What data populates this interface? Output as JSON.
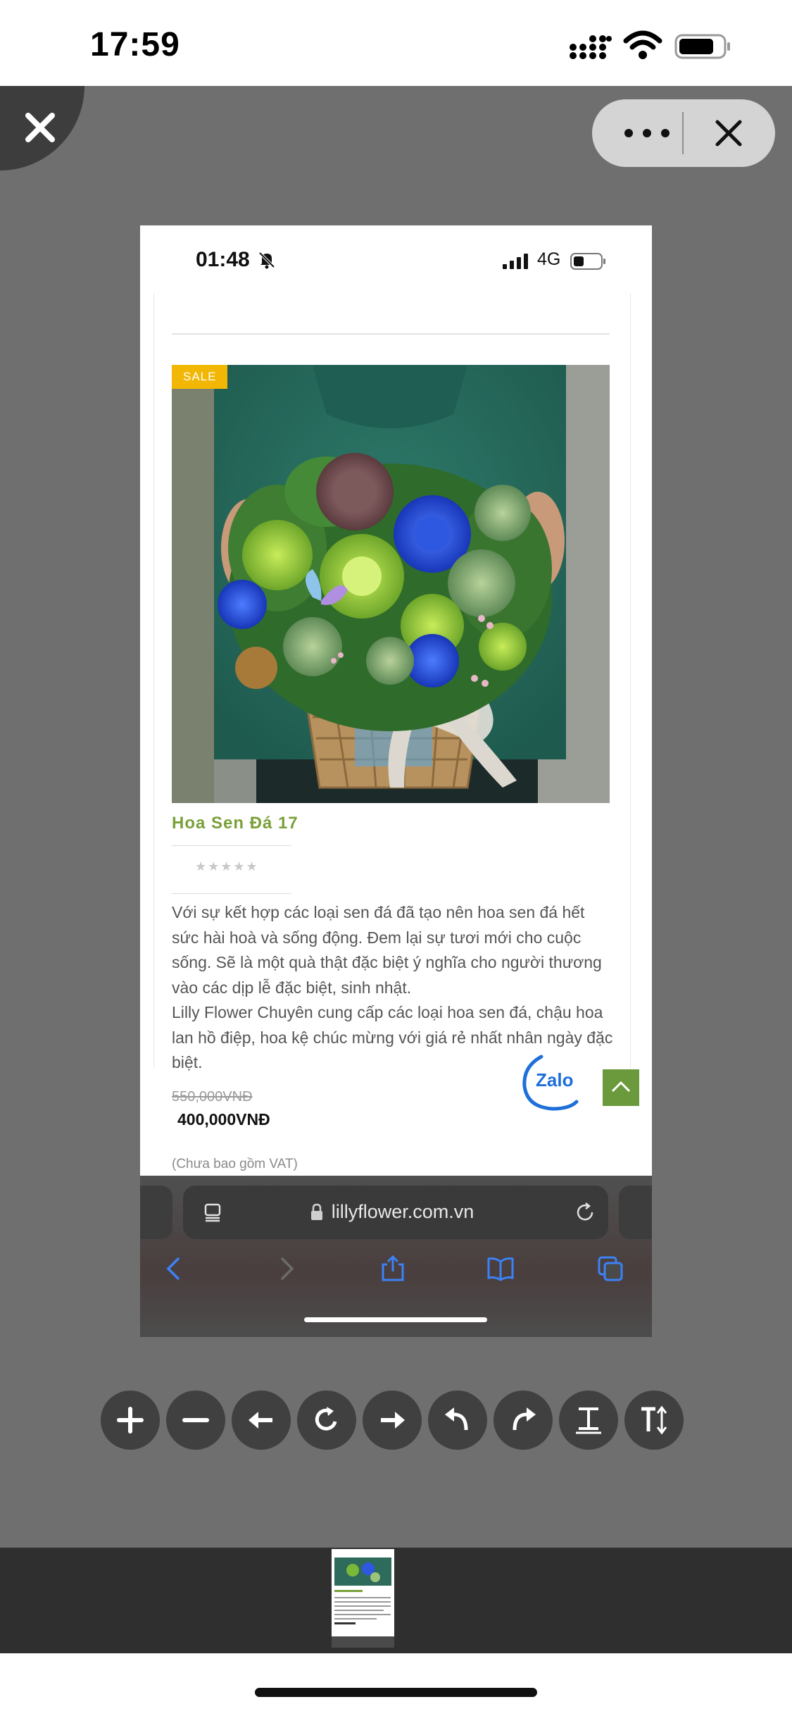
{
  "status_bar": {
    "time": "17:59"
  },
  "viewer": {
    "close_icon": "close-icon",
    "more_icon": "more-dots-icon",
    "pill_close_icon": "close-icon"
  },
  "inner_status": {
    "time": "01:48",
    "network": "4G"
  },
  "product": {
    "sale_badge": "SALE",
    "title": "Hoa Sen Đá 17",
    "stars": "★★★★★",
    "description": "Với sự kết hợp các loại sen đá đã tạo nên hoa sen đá hết sức hài hoà và sống động. Đem lại sự tươi mới cho cuộc sống. Sẽ là một quà thật đặc biệt ý nghĩa cho người thương vào các dịp lễ đặc biệt, sinh nhật.\nLilly Flower Chuyên cung cấp các loại hoa sen đá, chậu hoa lan hồ điệp, hoa kệ chúc mừng với giá rẻ nhất nhân ngày đặc biệt.",
    "price_old": "550,000VNĐ",
    "price_new": "400,000VNĐ",
    "vat_note": "(Chưa bao gồm VAT)"
  },
  "chat_widget": {
    "label": "Zalo"
  },
  "browser": {
    "url": "lillyflower.com.vn"
  },
  "toolbar": {
    "tools": [
      "zoom-in",
      "zoom-out",
      "move-left",
      "rotate",
      "move-right",
      "undo",
      "redo",
      "text-format",
      "text-size"
    ]
  },
  "colors": {
    "viewer_bg": "#6f6f6f",
    "title_green": "#7aa03a",
    "sale_yellow": "#f2b705",
    "back_to_top_green": "#6a9a3b"
  }
}
